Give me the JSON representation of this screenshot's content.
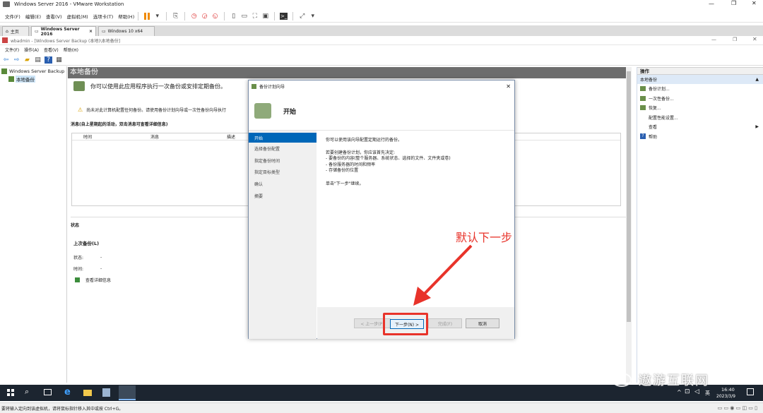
{
  "vm_window": {
    "title": "Windows Server 2016 - VMware Workstation",
    "controls": [
      "—",
      "❐",
      "✕"
    ],
    "menu": [
      "文件(F)",
      "编辑(E)",
      "查看(V)",
      "虚拟机(M)",
      "选项卡(T)",
      "帮助(H)"
    ],
    "tabs": [
      {
        "label": "主页"
      },
      {
        "label": "Windows Server 2016",
        "active": true
      },
      {
        "label": "Windows 10 x64"
      }
    ]
  },
  "guest_window": {
    "title": "wbadmin - [Windows Server Backup (本地)\\本地备份]",
    "menu": [
      "文件(F)",
      "操作(A)",
      "查看(V)",
      "帮助(H)"
    ]
  },
  "tree": {
    "root": "Windows Server Backup",
    "child": "本地备份"
  },
  "main": {
    "header": "本地备份",
    "intro": "你可以使用此应用程序执行一次备份或安排定期备份。",
    "warning": "尚未对此计算机配置任何备份。请使用备份计划向导或一次性备份向导执行",
    "messages_title": "消息(自上星期起的活动，双击消息可查看详细信息)",
    "columns": [
      "时间",
      "消息",
      "描述"
    ],
    "status_title": "状态",
    "last_backup_title": "上次备份(L)",
    "status_label": "状态:",
    "status_value": "-",
    "time_label": "时间:",
    "time_value": "-",
    "details_link": "查看详细信息"
  },
  "actions": {
    "title": "操作",
    "section": "本地备份",
    "items": [
      "备份计划...",
      "一次性备份...",
      "恢复...",
      "配置性能设置...",
      "查看",
      "帮助"
    ]
  },
  "dialog": {
    "title": "备份计划向导",
    "heading": "开始",
    "steps": [
      "开始",
      "选择备份配置",
      "指定备份时间",
      "指定目标类型",
      "确认",
      "摘要"
    ],
    "active_step": 0,
    "body_line1": "你可以使用该向导配置定期运行的备份。",
    "body_intro": "若要创建备份计划，你应该首先决定:",
    "bullets": [
      "- 要备份的内容(整个服务器、系统状态、选择的文件、文件夹或卷)",
      "- 备份服务器的时间和频率",
      "- 存储备份的位置"
    ],
    "body_continue": "单击\"下一步\"继续。",
    "buttons": {
      "prev": "< 上一步(P)",
      "next": "下一步(N) >",
      "finish": "完成(F)",
      "cancel": "取消"
    }
  },
  "annotation": {
    "text": "默认下一步",
    "color": "#e8332a"
  },
  "taskbar": {
    "time": "16:40",
    "date": "2023/3/9",
    "lang": "英"
  },
  "watermark": "遨游互联网",
  "statusbar": {
    "hint": "要将输入定向到该虚拟机，请将鼠标指针移入其中或按 Ctrl+G。"
  }
}
